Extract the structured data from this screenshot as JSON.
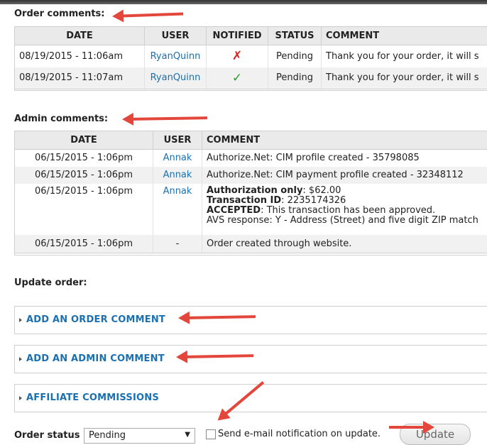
{
  "order_comments": {
    "title": "Order comments:",
    "headers": [
      "DATE",
      "USER",
      "NOTIFIED",
      "STATUS",
      "COMMENT"
    ],
    "rows": [
      {
        "date": "08/19/2015 - 11:06am",
        "user": "RyanQuinn",
        "notified": "✗",
        "status": "Pending",
        "comment": "Thank you for your order, it will s"
      },
      {
        "date": "08/19/2015 - 11:07am",
        "user": "RyanQuinn",
        "notified": "✓",
        "status": "Pending",
        "comment": "Thank you for your order, it will s"
      }
    ]
  },
  "admin_comments": {
    "title": "Admin comments:",
    "headers": [
      "DATE",
      "USER",
      "COMMENT"
    ],
    "rows": [
      {
        "date": "06/15/2015 - 1:06pm",
        "user": "Annak",
        "comment": "Authorize.Net: CIM profile created - 35798085"
      },
      {
        "date": "06/15/2015 - 1:06pm",
        "user": "Annak",
        "comment": "Authorize.Net: CIM payment profile created - 32348112"
      },
      {
        "date": "06/15/2015 - 1:06pm",
        "user": "Annak",
        "auth_label": "Authorization only",
        "auth_value": ": $62.00",
        "txn_label": "Transaction ID",
        "txn_value": ": 2235174326",
        "acc_label": "ACCEPTED",
        "acc_value": ": This transaction has been approved.",
        "avs": "AVS response: Y - Address (Street) and five digit ZIP match"
      },
      {
        "date": "06/15/2015 - 1:06pm",
        "user": "-",
        "comment": "Order created through website."
      }
    ]
  },
  "update_order": {
    "title": "Update order:",
    "fieldsets": [
      "ADD AN ORDER COMMENT",
      "ADD AN ADMIN COMMENT",
      "AFFILIATE COMMISSIONS"
    ],
    "status_label": "Order status",
    "status_value": "Pending",
    "notify_label": "Send e-mail notification on update.",
    "update_button": "Update"
  },
  "colors": {
    "link": "#1a70b0",
    "annotation_arrow": "#e3473b",
    "cross": "#d82020",
    "check": "#2e9b2e"
  }
}
